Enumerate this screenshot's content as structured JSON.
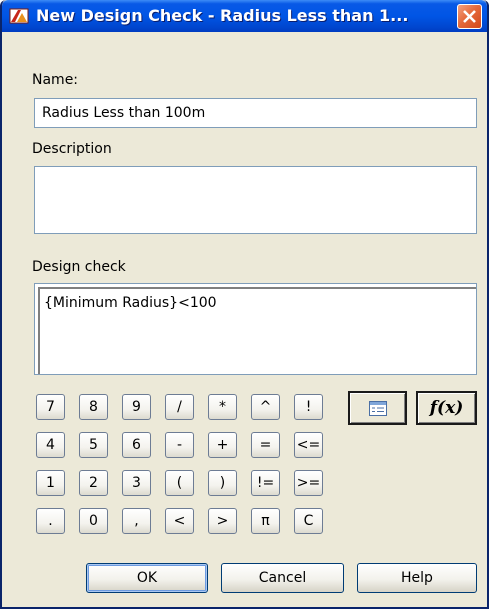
{
  "window": {
    "title": "New Design Check - Radius Less than 1...",
    "app_icon": "autocad-civil-icon",
    "close_icon": "close-icon"
  },
  "form": {
    "name_label": "Name:",
    "name_value": "Radius Less than 100m",
    "description_label": "Description",
    "description_value": "",
    "design_check_label": "Design check",
    "design_check_value": "{Minimum Radius}<100"
  },
  "keypad": {
    "rows": [
      [
        "7",
        "8",
        "9",
        "/",
        "*",
        "^",
        "!"
      ],
      [
        "4",
        "5",
        "6",
        "-",
        "+",
        "=",
        "<="
      ],
      [
        "1",
        "2",
        "3",
        "(",
        ")",
        "!=",
        ">="
      ],
      [
        ".",
        "0",
        ",",
        "<",
        ">",
        "π",
        "C"
      ]
    ],
    "insert_property_icon": "property-list-icon",
    "function_label": "f(x)"
  },
  "buttons": {
    "ok": "OK",
    "cancel": "Cancel",
    "help": "Help"
  },
  "colors": {
    "titlebar": "#0055e5",
    "close_button": "#e56a3c",
    "dialog_background": "#ece9d8",
    "field_border": "#7f9db9"
  }
}
